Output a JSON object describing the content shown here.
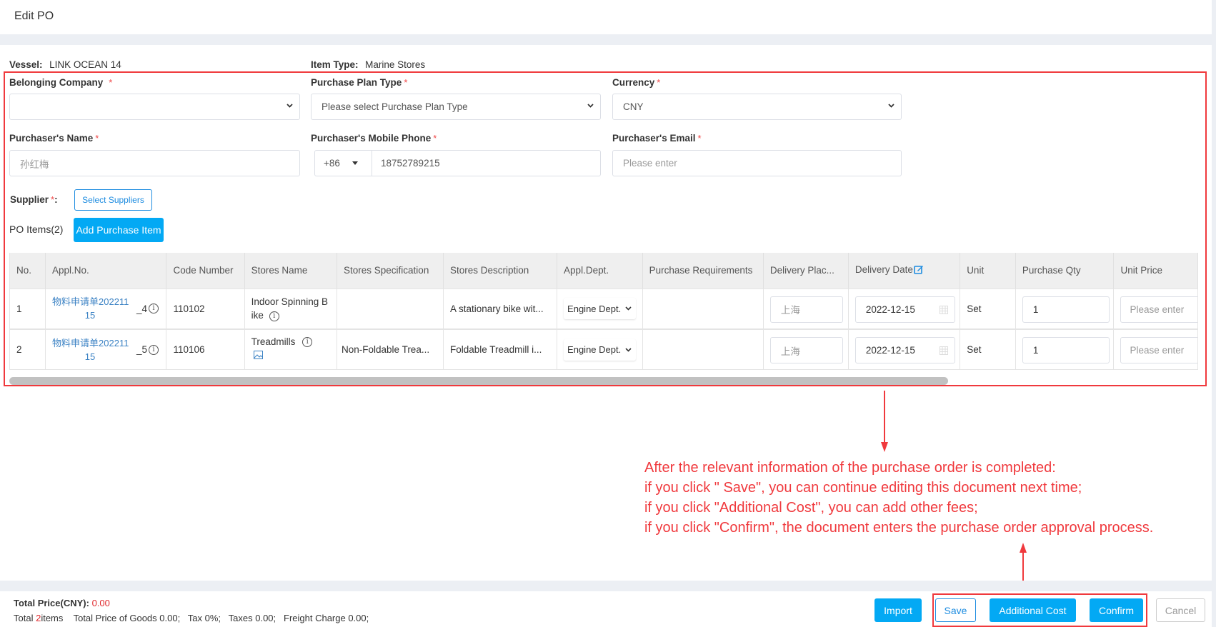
{
  "header": {
    "title": "Edit PO"
  },
  "info": {
    "vessel_label": "Vessel:",
    "vessel_value": "LINK OCEAN 14",
    "item_type_label": "Item Type:",
    "item_type_value": "Marine Stores"
  },
  "form": {
    "belonging_company": {
      "label": "Belonging Company",
      "required": "*",
      "value": ""
    },
    "purchase_plan_type": {
      "label": "Purchase Plan Type",
      "required": "*",
      "placeholder": "Please select Purchase Plan Type"
    },
    "currency": {
      "label": "Currency",
      "required": "*",
      "value": "CNY"
    },
    "purchaser_name": {
      "label": "Purchaser's Name",
      "required": "*",
      "placeholder": "孙红梅"
    },
    "purchaser_phone": {
      "label": "Purchaser's Mobile Phone",
      "required": "*",
      "country_code": "+86",
      "value": "18752789215"
    },
    "purchaser_email": {
      "label": "Purchaser's Email",
      "required": "*",
      "placeholder": "Please enter"
    },
    "supplier": {
      "label": "Supplier",
      "required": "*",
      "colon": ":",
      "button": "Select Suppliers"
    }
  },
  "po_items": {
    "label": "PO Items(2)",
    "add_button": "Add Purchase Item",
    "columns": [
      "No.",
      "Appl.No.",
      "Code Number",
      "Stores Name",
      "Stores Specification",
      "Stores Description",
      "Appl.Dept.",
      "Purchase Requirements",
      "Delivery Plac...",
      "Delivery Date",
      "Unit",
      "Purchase Qty",
      "Unit Price"
    ],
    "rows": [
      {
        "no": "1",
        "appl_no_line1": "物料申请单202211",
        "appl_no_line2": "15",
        "appl_no_suffix": "_4",
        "code": "110102",
        "name_line1": "Indoor Spinning B",
        "name_line2": "ike",
        "spec": "",
        "desc": "A stationary bike wit...",
        "dept": "Engine Dept.",
        "requirements": "",
        "delivery_place": "上海",
        "delivery_date": "2022-12-15",
        "unit": "Set",
        "qty": "1",
        "unit_price_placeholder": "Please enter"
      },
      {
        "no": "2",
        "appl_no_line1": "物料申请单202211",
        "appl_no_line2": "15",
        "appl_no_suffix": "_5",
        "code": "110106",
        "name_line1": "Treadmills",
        "name_line2": "",
        "spec": "Non-Foldable Trea...",
        "desc": "Foldable Treadmill i...",
        "dept": "Engine Dept.",
        "requirements": "",
        "delivery_place": "上海",
        "delivery_date": "2022-12-15",
        "unit": "Set",
        "qty": "1",
        "unit_price_placeholder": "Please enter"
      }
    ]
  },
  "annotation": {
    "lines": [
      "After the relevant information of the purchase order is completed:",
      "if you click \" Save\", you can continue editing this document next time;",
      "if you click \"Additional Cost\", you can add  other fees;",
      "if you  click \"Confirm\", the document enters the purchase order approval process."
    ],
    "color": "#f0393d"
  },
  "footer": {
    "total_price_label": "Total Price(CNY):",
    "total_price_value": "0.00",
    "total_prefix": "Total ",
    "item_count": "2",
    "items_suffix": "items",
    "goods": "Total Price of Goods 0.00;",
    "tax": "Tax 0%;",
    "taxes": "Taxes 0.00;",
    "freight": "Freight Charge 0.00;",
    "buttons": {
      "import": "Import",
      "save": "Save",
      "additional_cost": "Additional Cost",
      "confirm": "Confirm",
      "cancel": "Cancel"
    }
  },
  "colors": {
    "primary": "#03a9f4",
    "link": "#3b82c4",
    "annotation_red": "#f0393d"
  }
}
